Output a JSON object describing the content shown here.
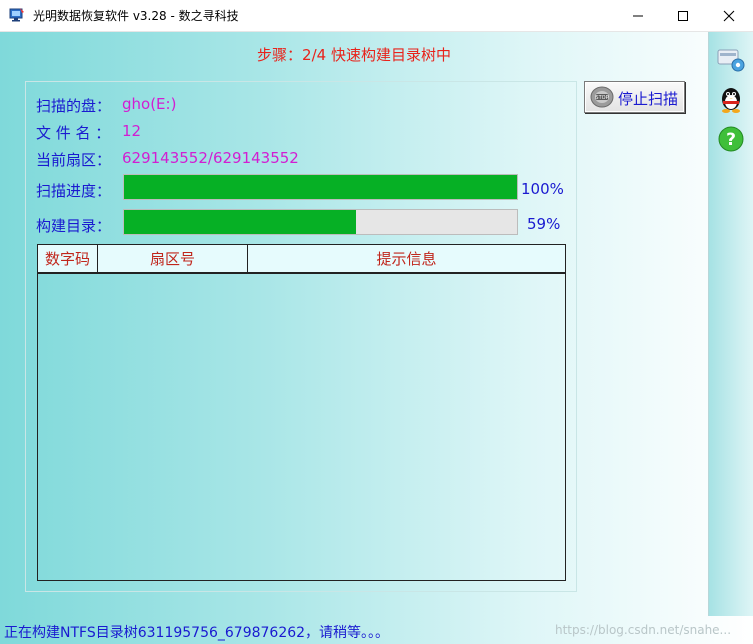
{
  "window": {
    "title": "光明数据恢复软件 v3.28 - 数之寻科技"
  },
  "step_text": "步骤：2/4 快速构建目录树中",
  "info": {
    "disk_label": "扫描的盘：",
    "disk_value": "gho(E:)",
    "file_label": "文 件 名 ：",
    "file_value": "12",
    "sector_label": "当前扇区：",
    "sector_value": "629143552/629143552"
  },
  "progress": {
    "scan_label": "扫描进度：",
    "scan_value": 100,
    "scan_text": "100%",
    "build_label": "构建目录：",
    "build_value": 59,
    "build_text": "59%"
  },
  "table": {
    "columns": [
      "数字码",
      "扇区号",
      "提示信息"
    ],
    "rows": []
  },
  "stop_button": {
    "label": "停止扫描"
  },
  "status_text": "正在构建NTFS目录树631195756_679876262，请稍等。。。",
  "watermark": "https://blog.csdn.net/snahe...",
  "colors": {
    "progress_fill": "#06b025",
    "label_blue": "#1a1ad0",
    "value_magenta": "#d21ed2",
    "step_red": "#e8231b",
    "header_red": "#c0261c"
  }
}
